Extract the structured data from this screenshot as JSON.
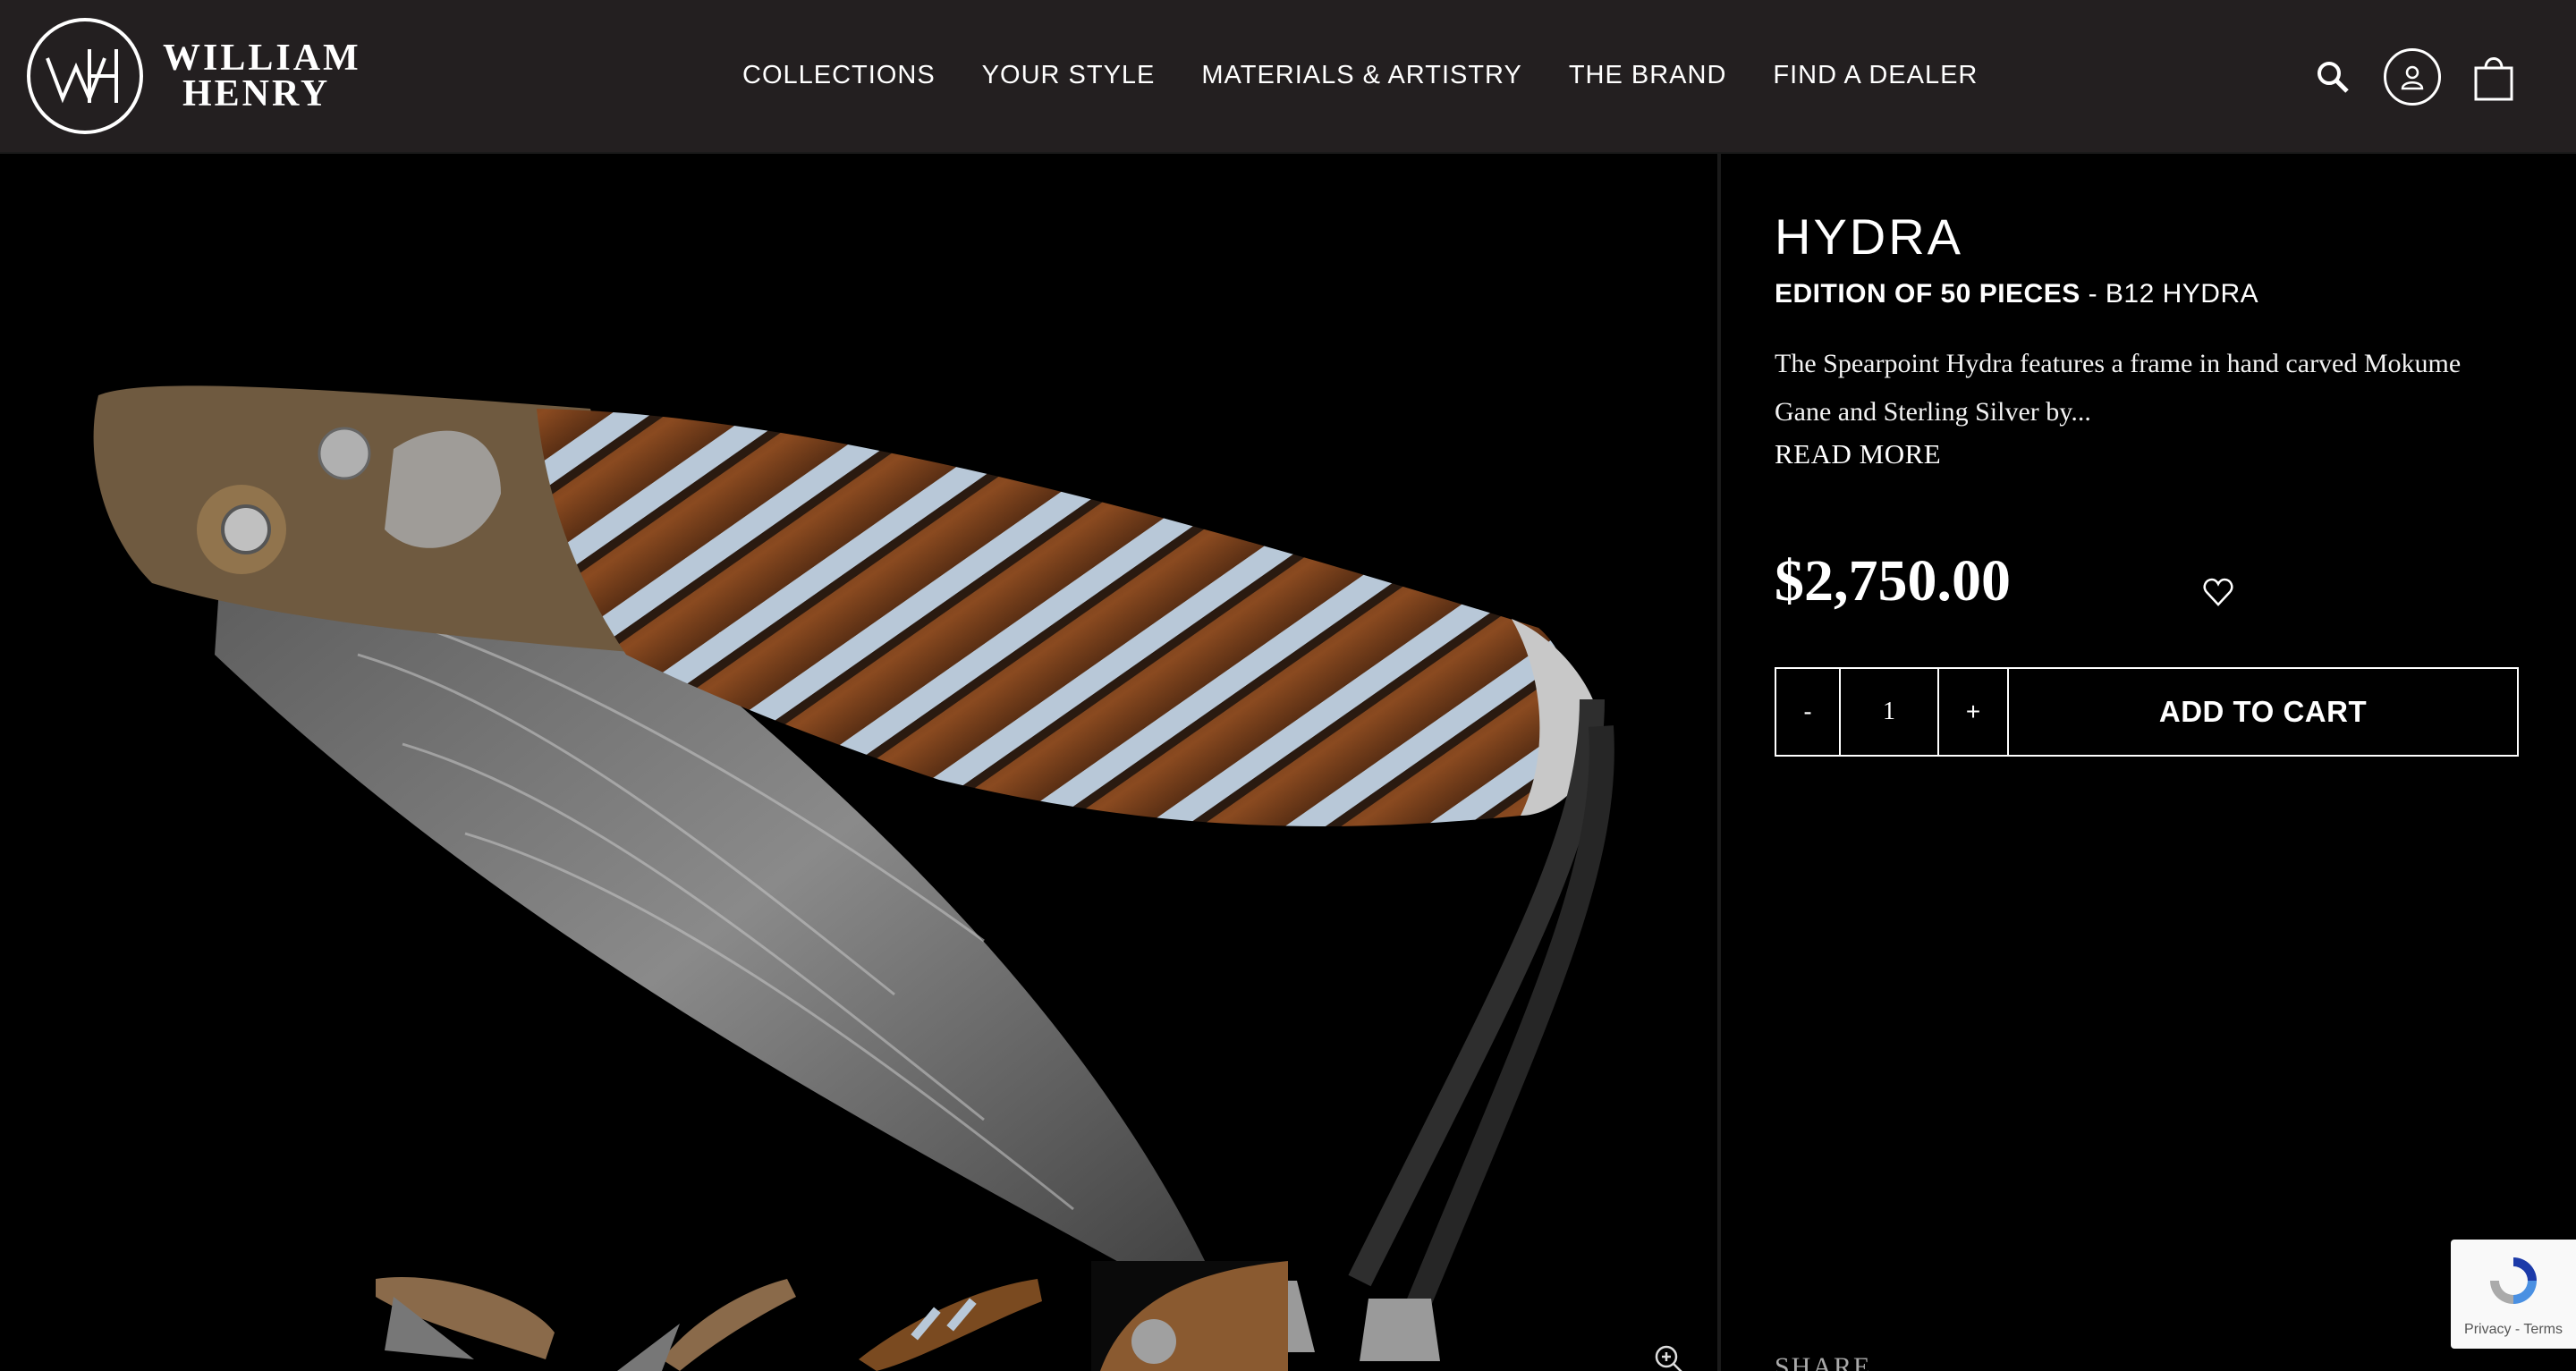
{
  "brand": {
    "line1": "WILLIAM",
    "line2": "HENRY",
    "mark": "WH"
  },
  "nav": {
    "items": [
      "COLLECTIONS",
      "YOUR STYLE",
      "MATERIALS & ARTISTRY",
      "THE BRAND",
      "FIND A DEALER"
    ]
  },
  "header_icons": [
    "search-icon",
    "account-icon",
    "cart-icon"
  ],
  "product": {
    "title": "HYDRA",
    "edition_bold": "EDITION OF 50 PIECES",
    "edition_rest": " - B12 HYDRA",
    "description": "The Spearpoint Hydra features a frame in hand carved Mokume Gane and Sterling Silver by...",
    "read_more": "READ MORE",
    "price": "$2,750.00",
    "quantity": "1",
    "qty_minus": "-",
    "qty_plus": "+",
    "add_to_cart": "ADD TO CART"
  },
  "share_label": "SHARE",
  "recaptcha": {
    "links": "Privacy - Terms"
  },
  "colors": {
    "header_bg": "#231f20",
    "page_bg": "#000000",
    "text": "#ffffff"
  }
}
